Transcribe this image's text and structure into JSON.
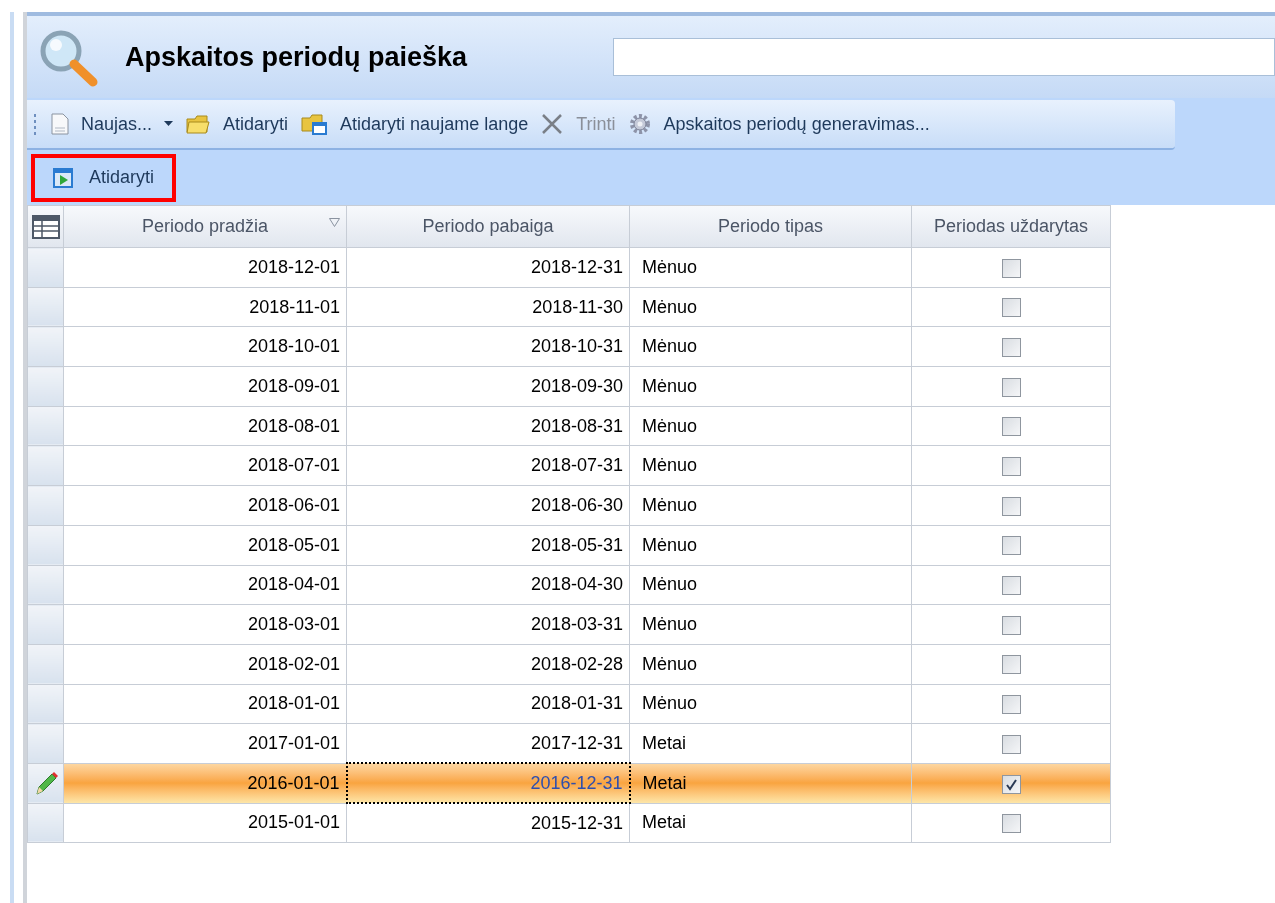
{
  "window": {
    "title": "Apskaitos periodų paieška"
  },
  "toolbar": [
    {
      "label": "Naujas...",
      "kind": "new",
      "dropdown": true,
      "disabled": false
    },
    {
      "label": "Atidaryti",
      "kind": "open",
      "dropdown": false,
      "disabled": false
    },
    {
      "label": "Atidaryti naujame lange",
      "kind": "open-window",
      "dropdown": false,
      "disabled": false
    },
    {
      "label": "Trinti",
      "kind": "delete",
      "dropdown": false,
      "disabled": true
    },
    {
      "label": "Apskaitos periodų generavimas...",
      "kind": "generate",
      "dropdown": false,
      "disabled": false
    }
  ],
  "action_button": {
    "label": "Atidaryti",
    "highlighted": true
  },
  "table": {
    "columns": [
      {
        "label": "Periodo pradžia",
        "sorted": true
      },
      {
        "label": "Periodo pabaiga",
        "sorted": false
      },
      {
        "label": "Periodo tipas",
        "sorted": false
      },
      {
        "label": "Periodas uždarytas",
        "sorted": false
      }
    ],
    "rows": [
      {
        "start": "2018-12-01",
        "end": "2018-12-31",
        "type": "Mėnuo",
        "closed": false,
        "selected": false
      },
      {
        "start": "2018-11-01",
        "end": "2018-11-30",
        "type": "Mėnuo",
        "closed": false,
        "selected": false
      },
      {
        "start": "2018-10-01",
        "end": "2018-10-31",
        "type": "Mėnuo",
        "closed": false,
        "selected": false
      },
      {
        "start": "2018-09-01",
        "end": "2018-09-30",
        "type": "Mėnuo",
        "closed": false,
        "selected": false
      },
      {
        "start": "2018-08-01",
        "end": "2018-08-31",
        "type": "Mėnuo",
        "closed": false,
        "selected": false
      },
      {
        "start": "2018-07-01",
        "end": "2018-07-31",
        "type": "Mėnuo",
        "closed": false,
        "selected": false
      },
      {
        "start": "2018-06-01",
        "end": "2018-06-30",
        "type": "Mėnuo",
        "closed": false,
        "selected": false
      },
      {
        "start": "2018-05-01",
        "end": "2018-05-31",
        "type": "Mėnuo",
        "closed": false,
        "selected": false
      },
      {
        "start": "2018-04-01",
        "end": "2018-04-30",
        "type": "Mėnuo",
        "closed": false,
        "selected": false
      },
      {
        "start": "2018-03-01",
        "end": "2018-03-31",
        "type": "Mėnuo",
        "closed": false,
        "selected": false
      },
      {
        "start": "2018-02-01",
        "end": "2018-02-28",
        "type": "Mėnuo",
        "closed": false,
        "selected": false
      },
      {
        "start": "2018-01-01",
        "end": "2018-01-31",
        "type": "Mėnuo",
        "closed": false,
        "selected": false
      },
      {
        "start": "2017-01-01",
        "end": "2017-12-31",
        "type": "Metai",
        "closed": false,
        "selected": false
      },
      {
        "start": "2016-01-01",
        "end": "2016-12-31",
        "type": "Metai",
        "closed": true,
        "selected": true
      },
      {
        "start": "2015-01-01",
        "end": "2015-12-31",
        "type": "Metai",
        "closed": false,
        "selected": false
      }
    ]
  }
}
